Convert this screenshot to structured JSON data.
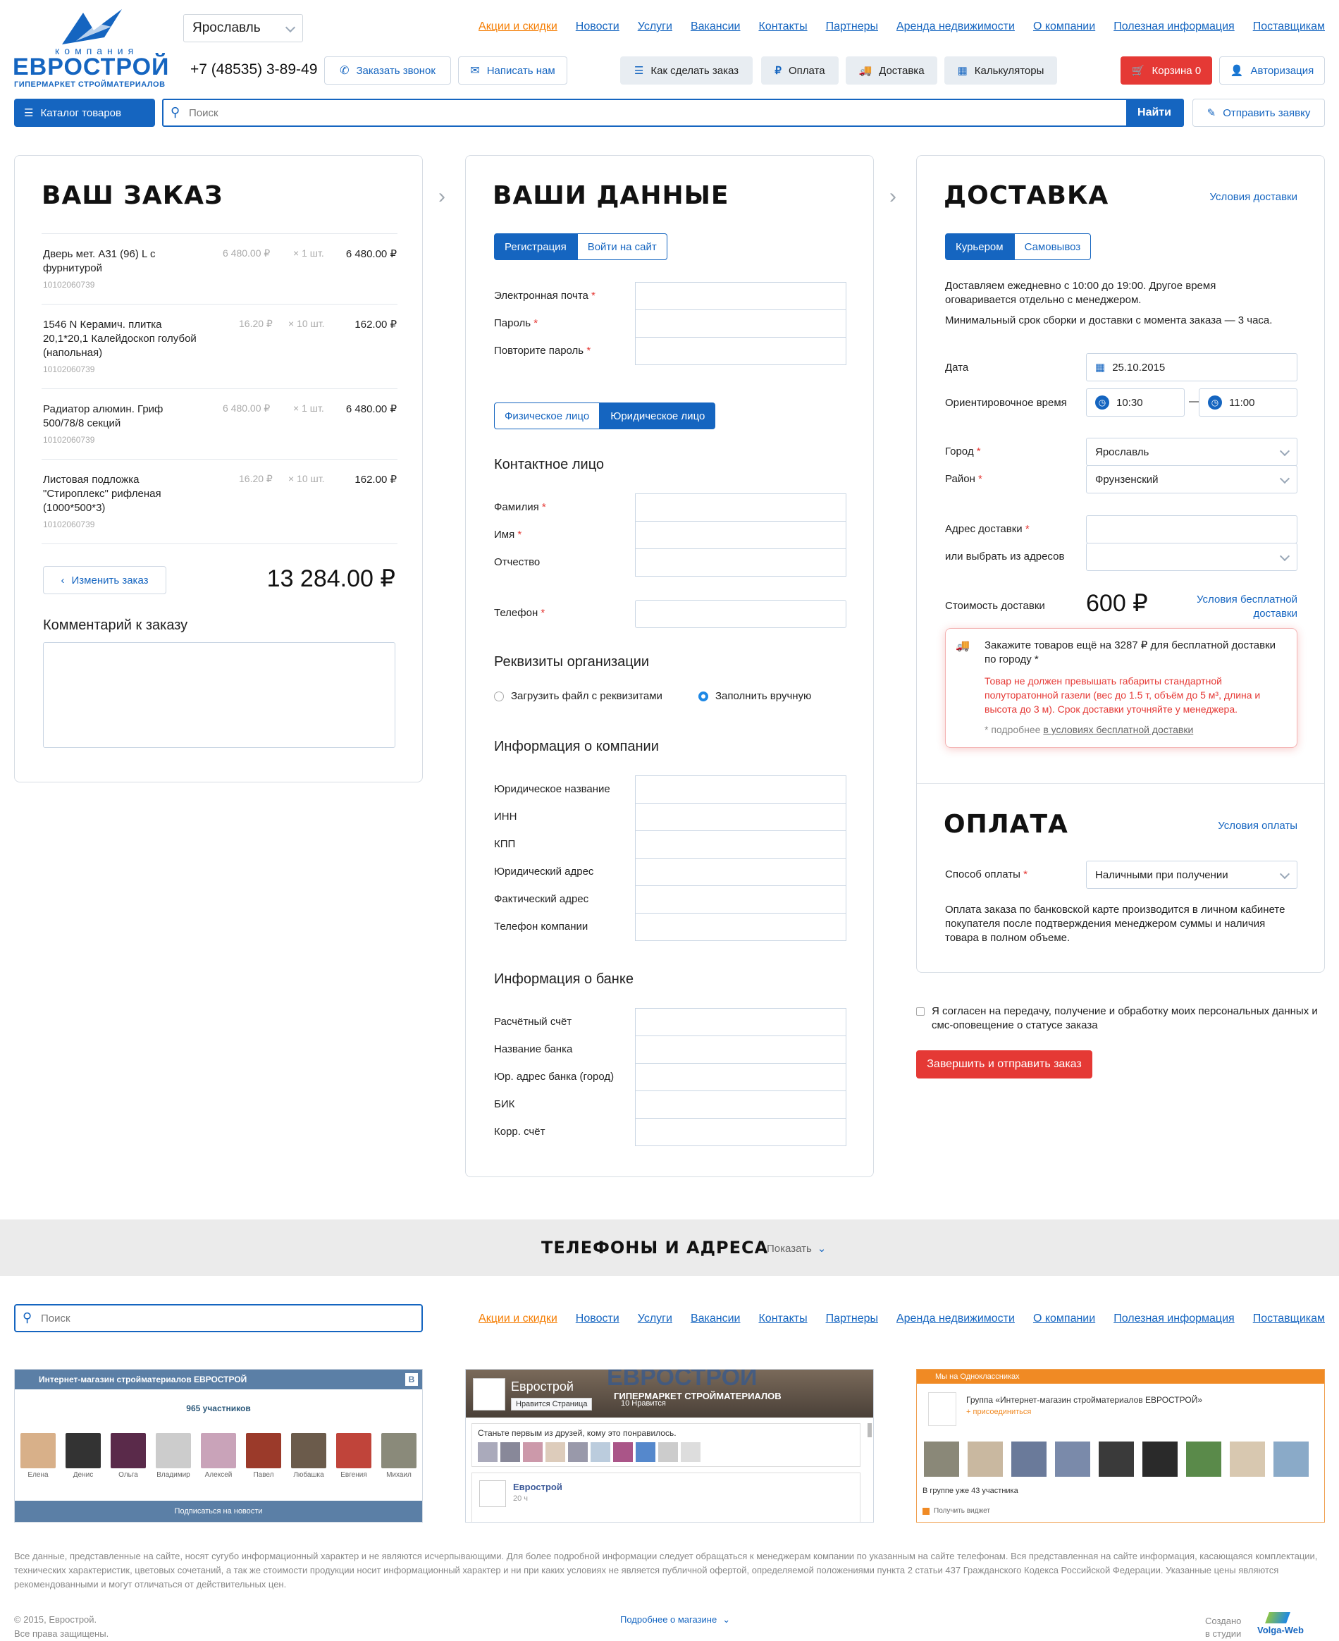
{
  "header": {
    "logo_small": "компания",
    "logo_big": "ЕВРОСТРОЙ",
    "logo_sub": "ГИПЕРМАРКЕТ СТРОЙМАТЕРИАЛОВ",
    "city": "Ярославль",
    "phone": "+7 (48535) 3-89-49",
    "call_btn": "Заказать звонок",
    "write_btn": "Написать нам",
    "nav": [
      "Акции и скидки",
      "Новости",
      "Услуги",
      "Вакансии",
      "Контакты",
      "Партнеры",
      "Аренда недвижимости",
      "О компании",
      "Полезная информация",
      "Поставщикам"
    ],
    "how_order": "Как сделать заказ",
    "payment": "Оплата",
    "delivery": "Доставка",
    "calculators": "Калькуляторы",
    "cart": "Корзина 0",
    "auth": "Авторизация",
    "catalog": "Каталог товаров",
    "search_placeholder": "Поиск",
    "search_btn": "Найти",
    "send_request": "Отправить заявку"
  },
  "order": {
    "title": "ВАШ ЗАКАЗ",
    "items": [
      {
        "name": "Дверь мет. А31 (96) L с фурнитурой",
        "code": "10102060739",
        "price": "6 480.00 ₽",
        "qty": "× 1 шт.",
        "sum": "6 480.00 ₽"
      },
      {
        "name": "1546 N Керамич. плитка 20,1*20,1 Калейдоскоп голубой (напольная)",
        "code": "10102060739",
        "price": "16.20 ₽",
        "qty": "× 10 шт.",
        "sum": "162.00 ₽"
      },
      {
        "name": "Радиатор алюмин. Гриф 500/78/8 секций",
        "code": "10102060739",
        "price": "6 480.00 ₽",
        "qty": "× 1 шт.",
        "sum": "6 480.00 ₽"
      },
      {
        "name": "Листовая подложка \"Стироплекс\" рифленая (1000*500*3)",
        "code": "10102060739",
        "price": "16.20 ₽",
        "qty": "× 10 шт.",
        "sum": "162.00 ₽"
      }
    ],
    "change_btn": "Изменить заказ",
    "total": "13 284.00 ₽",
    "comment_label": "Комментарий к заказу"
  },
  "data": {
    "title": "ВАШИ ДАННЫЕ",
    "tab_reg": "Регистрация",
    "tab_login": "Войти на сайт",
    "email": "Электронная почта",
    "password": "Пароль",
    "password2": "Повторите пароль",
    "tab_phys": "Физическое лицо",
    "tab_jur": "Юридическое лицо",
    "contact_title": "Контактное лицо",
    "surname": "Фамилия",
    "name": "Имя",
    "patronymic": "Отчество",
    "phone": "Телефон",
    "req_title": "Реквизиты организации",
    "radio_upload": "Загрузить файл с реквизитами",
    "radio_manual": "Заполнить вручную",
    "company_title": "Информация о компании",
    "company_fields": [
      "Юридическое название",
      "ИНН",
      "КПП",
      "Юридический адрес",
      "Фактический адрес",
      "Телефон компании"
    ],
    "bank_title": "Информация о банке",
    "bank_fields": [
      "Расчётный счёт",
      "Название банка",
      "Юр. адрес банка (город)",
      "БИК",
      "Корр. счёт"
    ]
  },
  "delivery": {
    "title": "ДОСТАВКА",
    "conditions": "Условия доставки",
    "tab_courier": "Курьером",
    "tab_pickup": "Самовывоз",
    "info1": "Доставляем ежедневно с 10:00 до 19:00. Другое время оговаривается отдельно с менеджером.",
    "info2": "Минимальный срок сборки и доставки с момента заказа — 3 часа.",
    "date_label": "Дата",
    "date_value": "25.10.2015",
    "time_label": "Ориентировочное время",
    "time_from": "10:30",
    "time_to": "11:00",
    "dash": "—",
    "city_label": "Город",
    "city_value": "Ярославль",
    "district_label": "Район",
    "district_value": "Фрунзенский",
    "address_label": "Адрес доставки",
    "address_choose": "или выбрать из адресов",
    "cost_label": "Стоимость доставки",
    "cost_value": "600 ₽",
    "free_link": "Условия бесплатной доставки",
    "tip_main": "Закажите товаров ещё на 3287 ₽ для бесплатной доставки по городу *",
    "tip_warn": "Товар не должен превышать габариты стандартной полуторатонной газели (вес до 1.5 т, объём до 5 м³, длина и высота до 3 м). Срок доставки уточняйте у менеджера.",
    "tip_more_prefix": "* подробнее ",
    "tip_more_link": "в условиях бесплатной доставки"
  },
  "payment": {
    "title": "ОПЛАТА",
    "conditions": "Условия оплаты",
    "method_label": "Способ оплаты",
    "method_value": "Наличными при получении",
    "info": "Оплата заказа по банковской карте производится в личном кабинете покупателя после подтверждения менеджером суммы и наличия товара в полном объеме."
  },
  "agree": "Я согласен на передачу, получение и обработку моих персональных данных и смс-оповещение о статусе заказа",
  "submit": "Завершить и отправить заказ",
  "phones": {
    "title": "ТЕЛЕФОНЫ И АДРЕСА",
    "show": "Показать"
  },
  "footer": {
    "search_placeholder": "Поиск",
    "vk": {
      "title": "Интернет-магазин стройматериалов ЕВРОСТРОЙ",
      "members": "965 участников",
      "names": [
        "Елена",
        "Денис",
        "Ольга",
        "Владимир",
        "Алексей",
        "Павел",
        "Любашка",
        "Евгения",
        "Михаил"
      ],
      "subscribe": "Подписаться на новости",
      "logo": "В"
    },
    "fb": {
      "name": "Еврострой",
      "banner": "ЕВРОСТРОЙ",
      "banner_sub": "ГИПЕРМАРКЕТ СТРОЙМАТЕРИАЛОВ",
      "like": "Нравится Страница",
      "likes": "10 Нравится",
      "first": "Станьте первым из друзей, кому это понравилось.",
      "post_name": "Еврострой",
      "post_time": "20 ч"
    },
    "ok": {
      "header": "Мы на Одноклассниках",
      "group": "Группа «Интернет-магазин стройматериалов ЕВРОСТРОЙ»",
      "join": "присоединиться",
      "count": "В группе уже 43 участника",
      "widget": "Получить виджет"
    },
    "disclaimer": "Все данные, представленные на сайте, носят сугубо информационный характер и не являются исчерпывающими. Для более подробной информации следует обращаться к менеджерам компании по указанным на сайте телефонам. Вся представленная на сайте информация, касающаяся комплектации, технических характеристик, цветовых сочетаний, а так же стоимости продукции носит информационный характер и ни при каких условиях не является публичной офертой, определяемой положениями пункта 2 статьи 437 Гражданского Кодекса Российской Федерации. Указанные цены являются рекомендованными и могут отличаться от действительных цен.",
    "copyright": "© 2015, Еврострой.",
    "rights": "Все права защищены.",
    "more": "Подробнее о магазине",
    "created": "Создано",
    "studio": "в студии",
    "volga": "Volga-Web"
  }
}
